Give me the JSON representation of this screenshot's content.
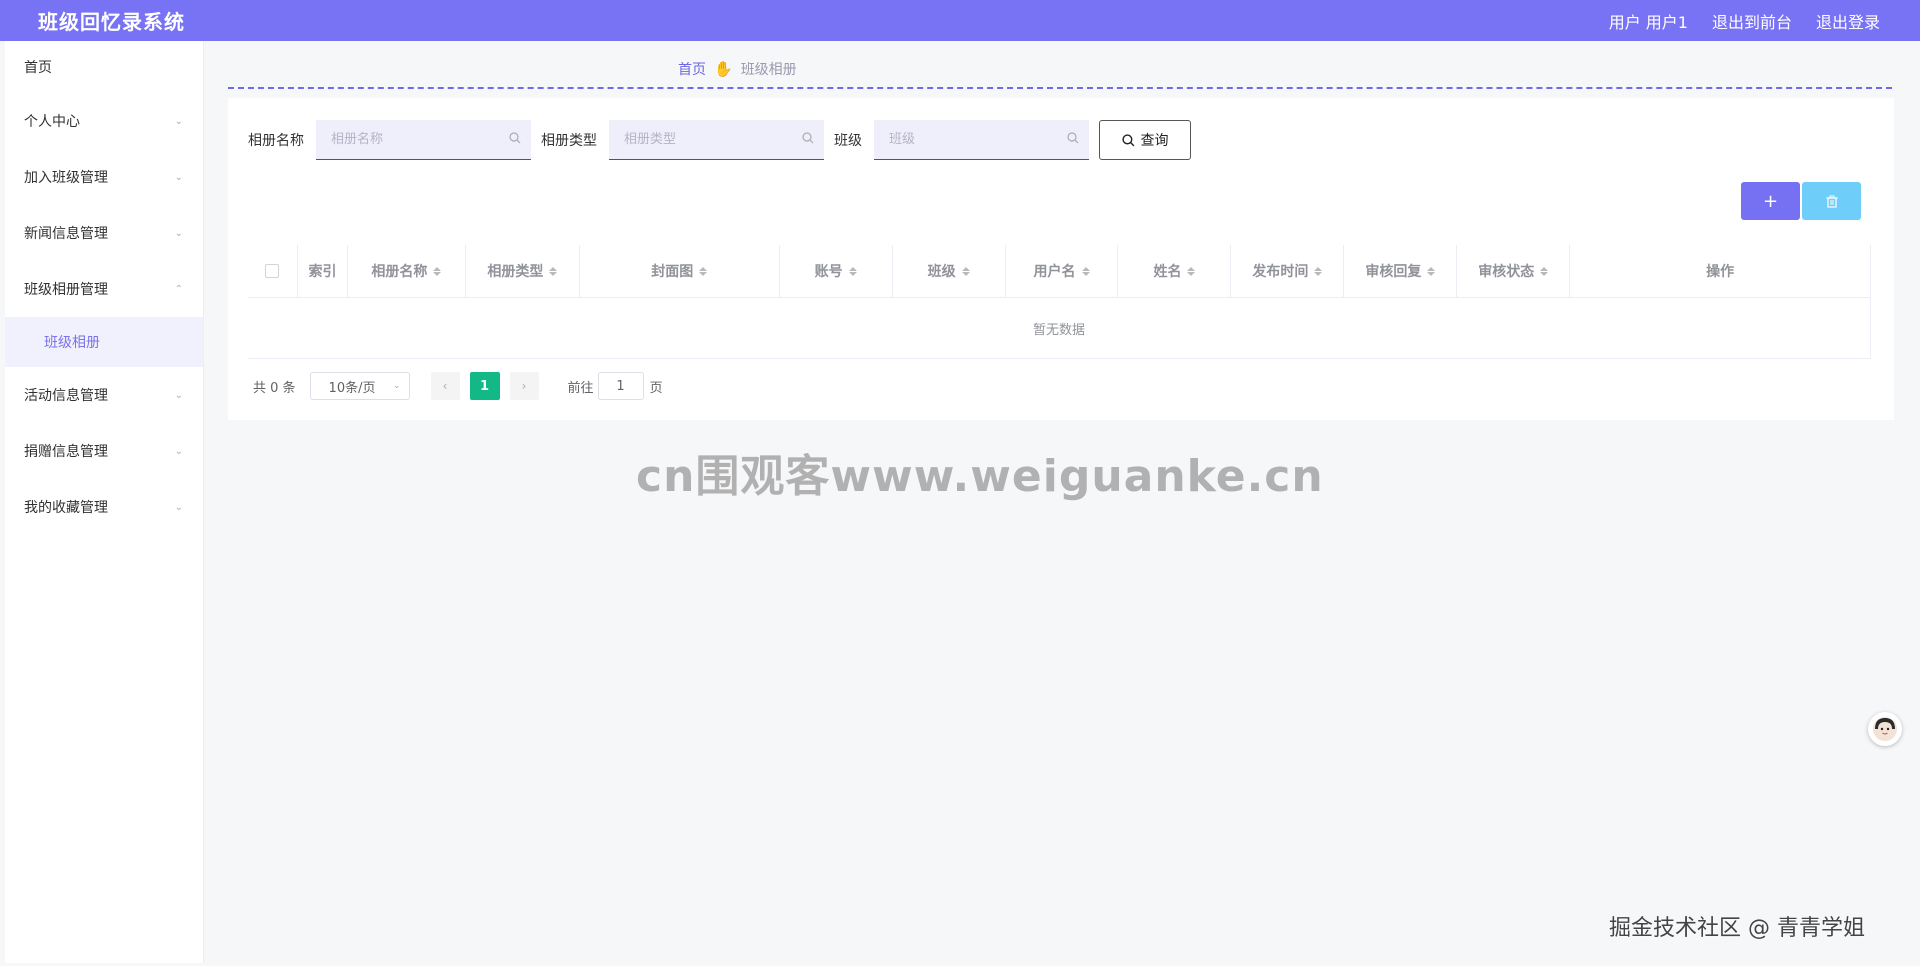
{
  "header": {
    "title": "班级回忆录系统",
    "user_label": "用户 用户1",
    "front_label": "退出到前台",
    "logout_label": "退出登录"
  },
  "sidebar": {
    "items": [
      {
        "label": "首页",
        "has_children": false
      },
      {
        "label": "个人中心",
        "has_children": true,
        "expanded": false
      },
      {
        "label": "加入班级管理",
        "has_children": true,
        "expanded": false
      },
      {
        "label": "新闻信息管理",
        "has_children": true,
        "expanded": false
      },
      {
        "label": "班级相册管理",
        "has_children": true,
        "expanded": true,
        "children": [
          {
            "label": "班级相册",
            "active": true
          }
        ]
      },
      {
        "label": "活动信息管理",
        "has_children": true,
        "expanded": false
      },
      {
        "label": "捐赠信息管理",
        "has_children": true,
        "expanded": false
      },
      {
        "label": "我的收藏管理",
        "has_children": true,
        "expanded": false
      }
    ]
  },
  "breadcrumb": {
    "home": "首页",
    "current": "班级相册"
  },
  "search": {
    "album_name_label": "相册名称",
    "album_name_placeholder": "相册名称",
    "album_type_label": "相册类型",
    "album_type_placeholder": "相册类型",
    "class_label": "班级",
    "class_placeholder": "班级",
    "query_label": "查询"
  },
  "toolbar": {
    "add_icon": "plus-icon",
    "delete_icon": "trash-icon"
  },
  "table": {
    "columns": [
      "索引",
      "相册名称",
      "相册类型",
      "封面图",
      "账号",
      "班级",
      "用户名",
      "姓名",
      "发布时间",
      "审核回复",
      "审核状态",
      "操作"
    ],
    "empty_text": "暂无数据"
  },
  "pagination": {
    "total": "共 0 条",
    "page_size": "10条/页",
    "current_page": "1",
    "goto_label": "前往",
    "goto_value": "1",
    "page_suffix": "页"
  },
  "watermarks": {
    "center": "cn围观客www.weiguanke.cn",
    "bottom_right": "掘金技术社区 @ 青青学姐"
  },
  "colors": {
    "header_bg": "#7872f5",
    "accent": "#6d65e6",
    "active_page": "#12b886",
    "delete_btn": "#6ecdf9"
  }
}
